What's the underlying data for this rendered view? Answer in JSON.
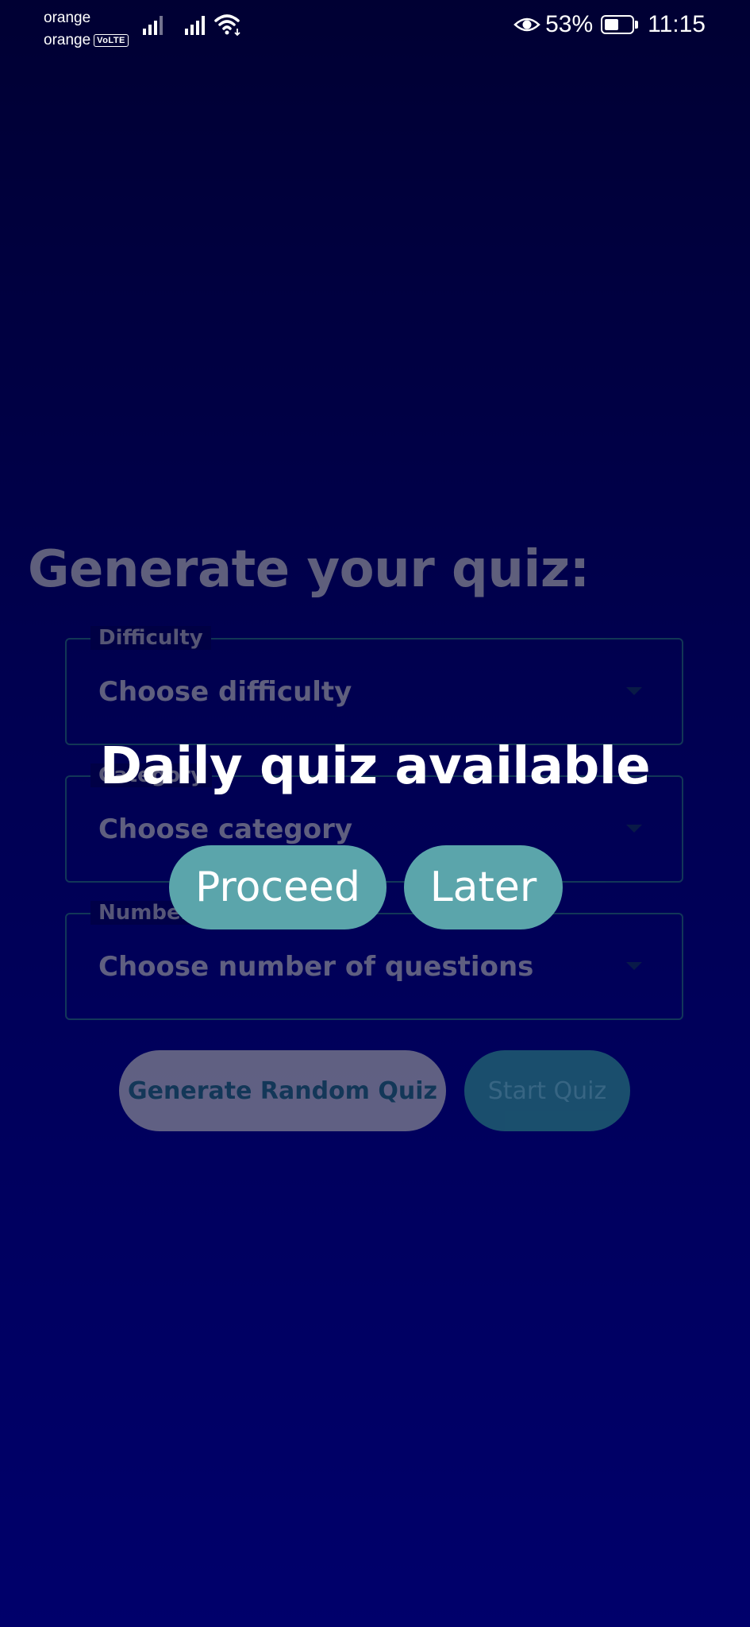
{
  "status_bar": {
    "carrier_1": "orange",
    "carrier_2": "orange",
    "volte": "VoLTE",
    "battery_percent": "53%",
    "battery_level": 0.53,
    "time": "11:15",
    "icons": [
      "signal-icon",
      "signal-icon",
      "wifi-icon",
      "eye-icon",
      "battery-icon"
    ]
  },
  "form": {
    "title": "Generate your quiz:",
    "difficulty": {
      "label": "Difficulty",
      "value": "Choose difficulty"
    },
    "category": {
      "label": "Category",
      "value": "Choose category"
    },
    "number": {
      "label": "Number",
      "value": "Choose number of questions"
    },
    "random_button": "Generate Random Quiz",
    "start_button": "Start Quiz"
  },
  "dialog": {
    "title": "Daily quiz available",
    "proceed": "Proceed",
    "later": "Later"
  },
  "colors": {
    "background_top": "#000033",
    "background_bottom": "#00006b",
    "popup_button": "#5ba5ab",
    "field_border": "#1e5a5a"
  }
}
